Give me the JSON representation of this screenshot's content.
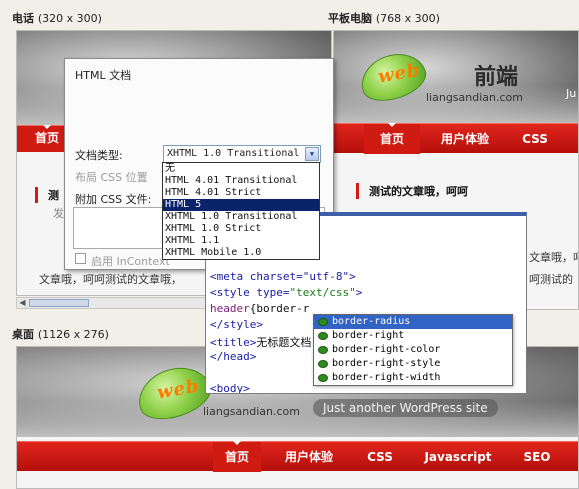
{
  "panes": {
    "phone": {
      "name": "电话",
      "size": "(320 x 300)"
    },
    "tablet": {
      "name": "平板电脑",
      "size": "(768 x 300)"
    },
    "desktop": {
      "name": "桌面",
      "size": "(1126 x 276)"
    }
  },
  "site": {
    "logo_web": "web",
    "logo_cn": "前端",
    "domain": "liangsandian.com",
    "tagline": "Just another WordPress site",
    "tablet_tagline_partial": "Ju",
    "nav": [
      "首页",
      "用户体验",
      "CSS",
      "Javascript",
      "SEO"
    ],
    "post_title": "测试的文章哦，呵呵",
    "phone_post_partial": "测",
    "phone_post_partial2": "发",
    "body_lines": [
      "文章哦，呵呵测试的文章哦，",
      "文章哦，呵呵",
      "呵测试的"
    ]
  },
  "dialog": {
    "title": "HTML 文档",
    "doctype_label": "文档类型:",
    "layout_css_label": "布局 CSS 位置",
    "attach_css_label": "附加 CSS 文件:",
    "enable_incontext_label": "启用 InContext",
    "selected_doctype": "XHTML 1.0 Transitional",
    "doctype_options": [
      "无",
      "HTML 4.01 Transitional",
      "HTML 4.01 Strict",
      "HTML 5",
      "XHTML 1.0 Transitional",
      "XHTML 1.0 Strict",
      "XHTML 1.1",
      "XHTML Mobile 1.0"
    ],
    "highlighted_option": 3
  },
  "editor": {
    "lines": [
      {
        "parts": [
          [
            "c-tag",
            "<meta charset=\"utf-8\">"
          ]
        ]
      },
      {
        "parts": [
          [
            "c-tag",
            "<style type="
          ],
          [
            "c-str",
            "\"text/css\""
          ],
          [
            "c-tag",
            ">"
          ]
        ]
      },
      {
        "parts": [
          [
            "c-prop",
            "header"
          ],
          [
            "c-plain",
            "{border-r"
          ]
        ]
      },
      {
        "parts": [
          [
            "c-tag",
            "</style>"
          ]
        ]
      },
      {
        "parts": [
          [
            "c-tag",
            "<title>"
          ],
          [
            "c-plain",
            "无标题文档"
          ]
        ]
      },
      {
        "parts": [
          [
            "c-tag",
            "</head>"
          ]
        ]
      },
      {
        "parts": [
          [
            "c-plain",
            ""
          ]
        ]
      },
      {
        "parts": [
          [
            "c-tag",
            "<body>"
          ]
        ]
      }
    ],
    "autocomplete": [
      "border-radius",
      "border-right",
      "border-right-color",
      "border-right-style",
      "border-right-width"
    ],
    "autocomplete_selected": 0
  },
  "colors": {
    "nav_red": "#c8150d",
    "accent_orange": "#ff7a00",
    "leaf_green": "#8fd14a",
    "selection_blue": "#0a246a"
  }
}
